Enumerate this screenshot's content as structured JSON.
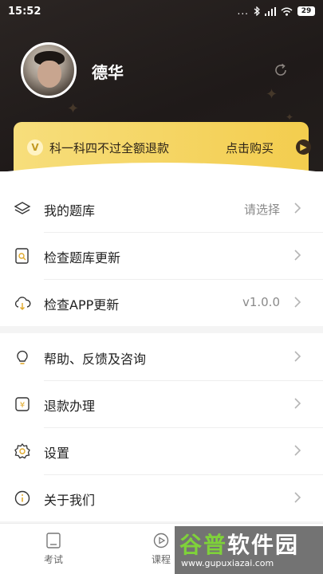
{
  "status_bar": {
    "time": "15:52",
    "dots": "...",
    "battery": "29",
    "icons": [
      "bluetooth-icon",
      "signal-icon",
      "wifi-icon",
      "battery-icon"
    ]
  },
  "profile": {
    "username": "德华",
    "avatar": "avatar-photo",
    "refresh_icon": "refresh-icon"
  },
  "banner": {
    "badge": "V",
    "text": "科一科四不过全额退款",
    "action": "点击购买",
    "arrow_icon": "chevron-right-circle-icon"
  },
  "menu_group_1": [
    {
      "icon": "layers-icon",
      "label": "我的题库",
      "value": "请选择"
    },
    {
      "icon": "search-doc-icon",
      "label": "检查题库更新",
      "value": ""
    },
    {
      "icon": "cloud-download-icon",
      "label": "检查APP更新",
      "value": "v1.0.0"
    }
  ],
  "menu_group_2": [
    {
      "icon": "lightbulb-icon",
      "label": "帮助、反馈及咨询",
      "value": ""
    },
    {
      "icon": "refund-icon",
      "label": "退款办理",
      "value": ""
    },
    {
      "icon": "gear-icon",
      "label": "设置",
      "value": ""
    },
    {
      "icon": "info-icon",
      "label": "关于我们",
      "value": ""
    }
  ],
  "tabs": [
    {
      "icon": "exam-icon",
      "label": "考试"
    },
    {
      "icon": "course-icon",
      "label": "课程"
    }
  ],
  "watermark": {
    "main_green": "谷普",
    "main_white": "软件园",
    "url": "www.gupuxiazai.com"
  },
  "colors": {
    "header_bg": "#231e1c",
    "banner_gold": "#f3cd4e",
    "watermark_green": "#7fd23a"
  }
}
